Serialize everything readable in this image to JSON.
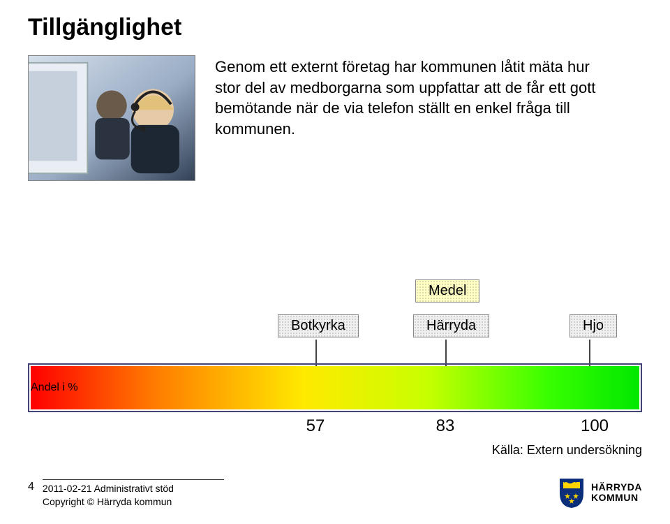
{
  "title": "Tillgänglighet",
  "description": "Genom ett externt företag har kommunen låtit mäta hur stor del av medborgarna som uppfattar att de får ett gott bemötande när de via telefon ställt en enkel fråga till kommunen.",
  "labels": {
    "botkyrka": "Botkyrka",
    "medel": "Medel",
    "harryda": "Härryda",
    "hjo": "Hjo"
  },
  "axis_label": "Andel i %",
  "values": {
    "v57": "57",
    "v83": "83",
    "v100": "100"
  },
  "source": "Källa: Extern undersökning",
  "footer": {
    "page": "4",
    "line1": "2011-02-21 Administrativt stöd",
    "line2": "Copyright © Härryda kommun",
    "logo_line1": "HÄRRYDA",
    "logo_line2": "KOMMUN"
  },
  "chart_data": {
    "type": "bar",
    "title": "Tillgänglighet",
    "ylabel": "Andel i %",
    "ylim": [
      0,
      100
    ],
    "categories": [
      "Botkyrka",
      "Härryda",
      "Hjo"
    ],
    "values": [
      57,
      83,
      100
    ],
    "annotations": [
      {
        "label": "Medel",
        "near": "Härryda"
      }
    ],
    "source": "Extern undersökning"
  }
}
